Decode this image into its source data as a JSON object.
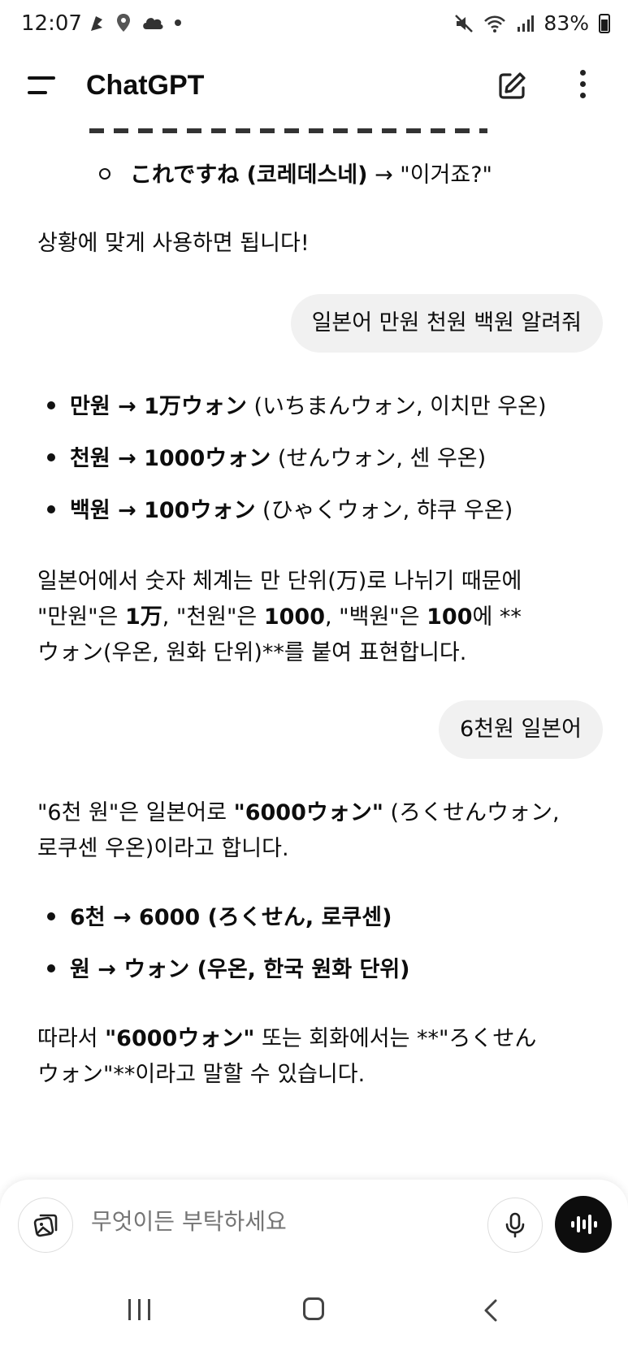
{
  "status_bar": {
    "time": "12:07",
    "battery": "83%",
    "icons": [
      "notification-icon",
      "location-icon",
      "cloud-icon",
      "dot-icon",
      "mute-icon",
      "wifi-icon",
      "signal-icon",
      "battery-icon"
    ]
  },
  "header": {
    "title": "ChatGPT"
  },
  "chat": {
    "partial_item": {
      "bold": "これですね (코레데스네)",
      "rest": " → \"이거죠?\""
    },
    "closing_1": "상황에 맞게 사용하면 됩니다!",
    "user_message_1": "일본어 만원 천원 백원 알려줘",
    "answer_1_items": [
      {
        "bold": "만원 → 1万ウォン",
        "rest": " (いちまんウォン, 이치만 우온)"
      },
      {
        "bold": "천원 → 1000ウォン",
        "rest": " (せんウォン, 센 우온)"
      },
      {
        "bold": "백원 → 100ウォン",
        "rest": " (ひゃくウォン, 햐쿠 우온)"
      }
    ],
    "answer_1_explain": {
      "line1": "일본어에서 숫자 체계는 만 단위(万)로 나뉘기 때문에",
      "line2_a": "\"만원\"은 ",
      "line2_b": "1万",
      "line2_c": ", \"천원\"은 ",
      "line2_d": "1000",
      "line2_e": ", \"백원\"은 ",
      "line2_f": "100",
      "line2_g": "에 **",
      "line3": "ウォン(우온, 원화 단위)**를 붙여 표현합니다."
    },
    "user_message_2": "6천원 일본어",
    "answer_2_intro": {
      "a": "\"6천 원\"은 일본어로 ",
      "b": "\"6000ウォン\"",
      "c": " (ろくせんウォン,",
      "line2": "로쿠센 우온)이라고 합니다."
    },
    "answer_2_items": [
      {
        "bold": "6천 → 6000 (ろくせん, 로쿠센)"
      },
      {
        "bold": "원 → ウォン (우온, 한국 원화 단위)"
      }
    ],
    "answer_2_closing": {
      "a": "따라서 ",
      "b": "\"6000ウォン\"",
      "c": " 또는 회화에서는 **\"ろくせん",
      "line2": "ウォン\"**이라고 말할 수 있습니다."
    }
  },
  "composer": {
    "placeholder": "무엇이든 부탁하세요"
  }
}
